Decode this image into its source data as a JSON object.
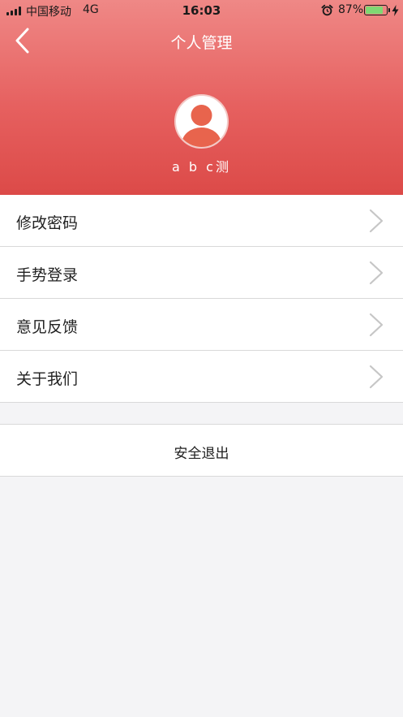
{
  "status_bar": {
    "carrier": "中国移动",
    "network": "4G",
    "time": "16:03",
    "battery_percent": "87%",
    "battery_level": 0.87,
    "icons": [
      "signal-icon",
      "alarm-icon",
      "battery-icon",
      "charging-bolt-icon"
    ]
  },
  "header": {
    "title": "个人管理",
    "back_icon": "chevron-left-icon",
    "username": "a b c测",
    "avatar_icon": "user-avatar-icon",
    "gradient_top": "#ef8886",
    "gradient_bottom": "#dc4a48"
  },
  "menu": {
    "items": [
      {
        "label": "修改密码",
        "icon": "chevron-right-icon"
      },
      {
        "label": "手势登录",
        "icon": "chevron-right-icon"
      },
      {
        "label": "意见反馈",
        "icon": "chevron-right-icon"
      },
      {
        "label": "关于我们",
        "icon": "chevron-right-icon"
      }
    ]
  },
  "logout": {
    "label": "安全退出"
  }
}
